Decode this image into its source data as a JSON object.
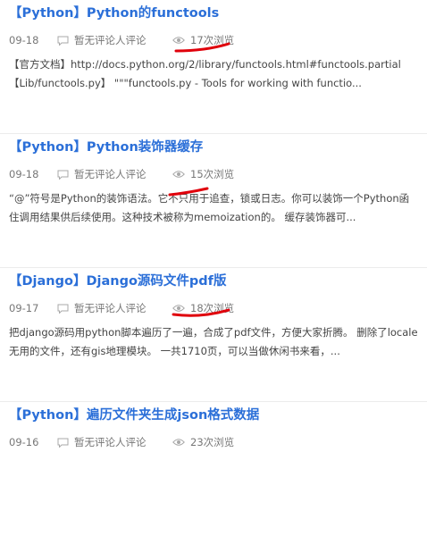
{
  "posts": [
    {
      "title": "【Python】Python的functools",
      "date": "09-18",
      "comments": "暂无评论人评论",
      "views": "17次浏览",
      "excerpt_line1": "【官方文档】http://docs.python.org/2/library/functools.html#functools.partial",
      "excerpt_line2": "【Lib/functools.py】 \"\"\"functools.py - Tools for working with functio..."
    },
    {
      "title": "【Python】Python装饰器缓存",
      "date": "09-18",
      "comments": "暂无评论人评论",
      "views": "15次浏览",
      "excerpt_line1": "“@”符号是Python的装饰语法。它不只用于追查，锁或日志。你可以装饰一个Python函",
      "excerpt_line2": "住调用结果供后续使用。这种技术被称为memoization的。 缓存装饰器可..."
    },
    {
      "title": "【Django】Django源码文件pdf版",
      "date": "09-17",
      "comments": "暂无评论人评论",
      "views": "18次浏览",
      "excerpt_line1": "把django源码用python脚本遍历了一遍，合成了pdf文件，方便大家折腾。 删除了locale",
      "excerpt_line2": "无用的文件，还有gis地理模块。 一共1710页，可以当做休闲书来看，..."
    },
    {
      "title": "【Python】遍历文件夹生成json格式数据",
      "date": "09-16",
      "comments": "暂无评论人评论",
      "views": "23次浏览",
      "excerpt_line1": "",
      "excerpt_line2": ""
    }
  ],
  "colors": {
    "title": "#2b6fd8",
    "meta": "#777777",
    "excerpt": "#444444",
    "annotation": "#e0000b"
  },
  "icons": {
    "comment": "comment-icon",
    "views": "eye-icon"
  }
}
